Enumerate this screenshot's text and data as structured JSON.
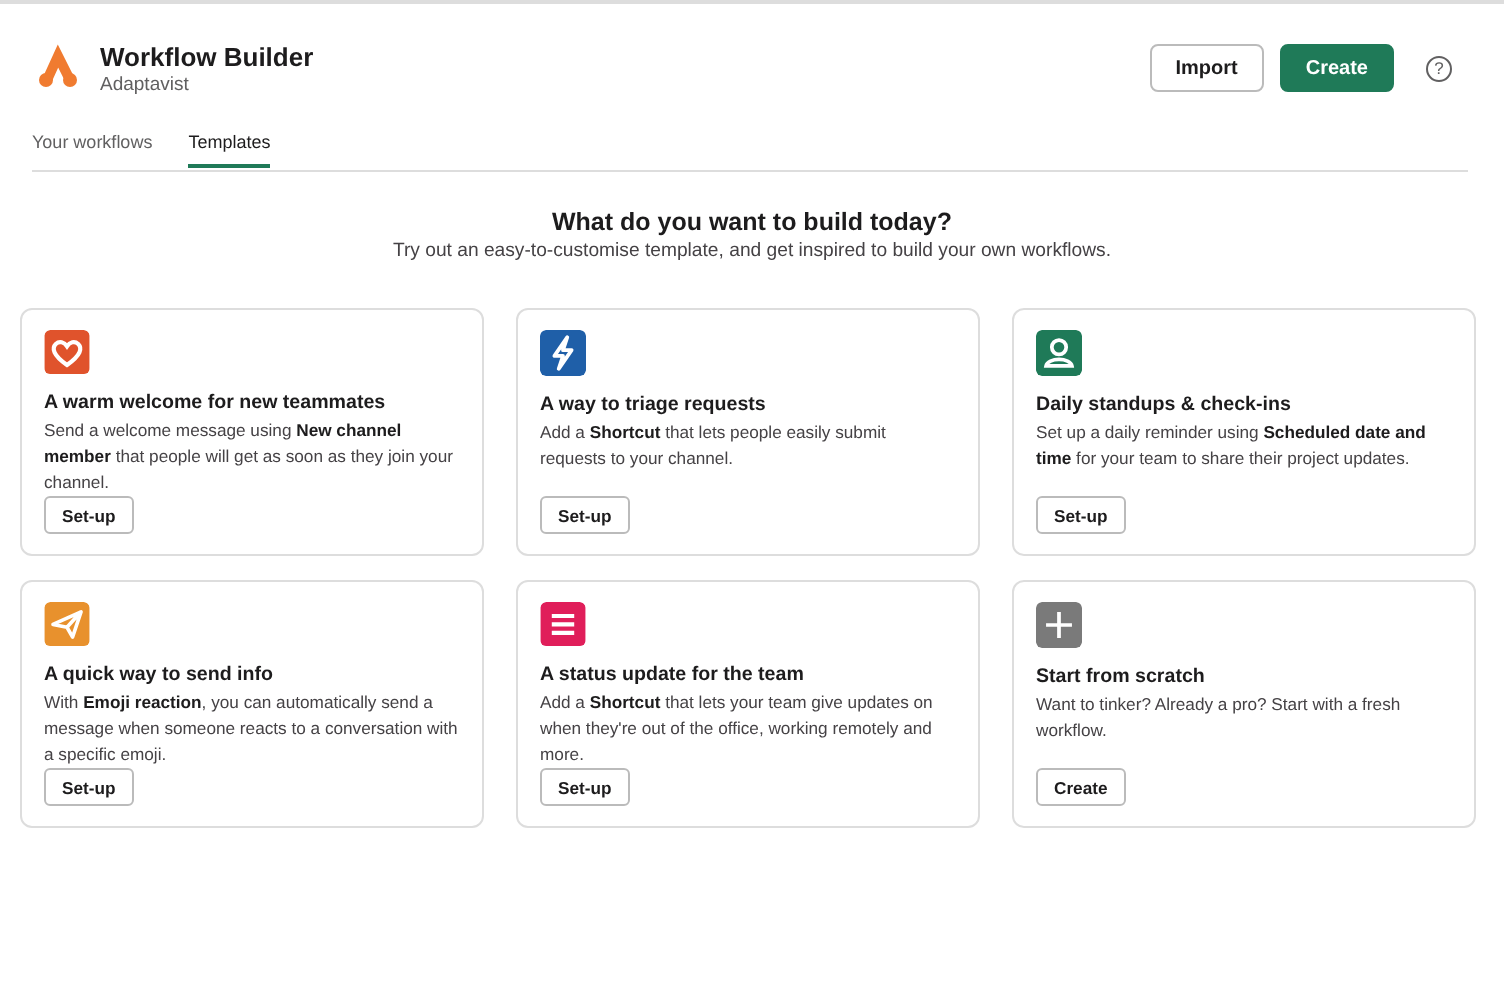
{
  "app": {
    "name": "Workflow Builder",
    "workspace": "Adaptavist"
  },
  "actions": [
    {
      "label": "Import",
      "kind": "secondary"
    },
    {
      "label": "Create",
      "kind": "primary"
    }
  ],
  "help": {
    "label": "?"
  },
  "tabs": [
    {
      "label": "Your workflows",
      "selected": false
    },
    {
      "label": "Templates",
      "selected": true
    }
  ],
  "heading": "What do you want to build today?",
  "subheading": "Try out an easy-to-customise template, and get inspired to build your own workflows.",
  "templates": [
    {
      "kind": "heart",
      "color": "#e0532c",
      "title": "A warm welcome for new teammates",
      "description": "Send a welcome message using **New channel member** that people will get as soon as they join your channel.",
      "button": "Set-up"
    },
    {
      "kind": "bolt",
      "color": "#1f5fa8",
      "title": "A way to triage requests",
      "description": "Add a **Shortcut** that lets people easily submit requests to your channel.",
      "button": "Set-up"
    },
    {
      "kind": "person",
      "color": "#1f7a58",
      "title": "Daily standups & check-ins",
      "description": "Set up a daily reminder using **Scheduled date and time** for your team to share their project updates.",
      "button": "Set-up"
    },
    {
      "kind": "plane",
      "color": "#e8912d",
      "title": "A quick way to send info",
      "description": "With **Emoji reaction**, you can automatically send a message when someone reacts to a conversation with a specific emoji.",
      "button": "Set-up"
    },
    {
      "kind": "list",
      "color": "#e01e5a",
      "title": "A status update for the team",
      "description": "Add a **Shortcut** that lets your team give updates on when they're out of the office, working remotely and more.",
      "button": "Set-up"
    },
    {
      "kind": "plus",
      "color": "#7a7a7a",
      "title": "Start from scratch",
      "description": "Want to tinker? Already a pro? Start with a fresh workflow.",
      "button": "Create"
    }
  ]
}
